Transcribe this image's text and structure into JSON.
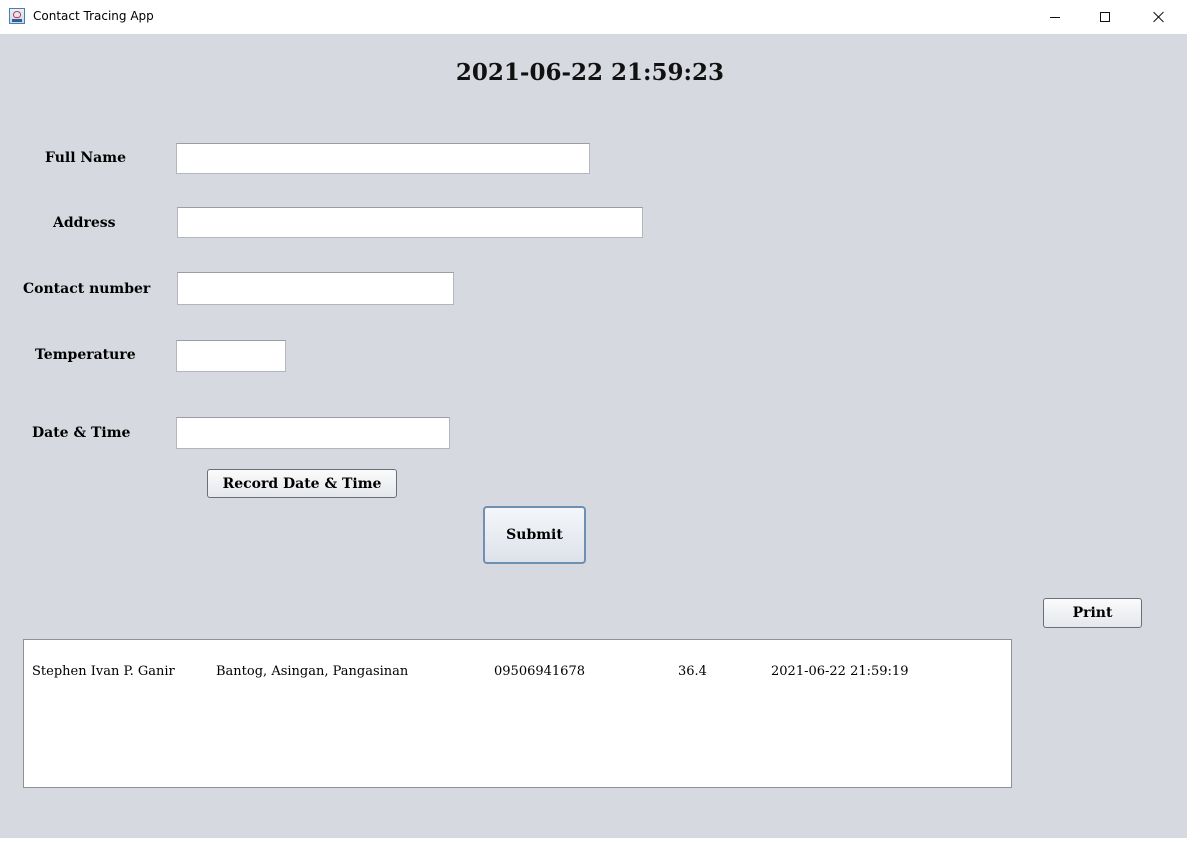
{
  "window": {
    "title": "Contact Tracing App",
    "controls": {
      "minimize": "minimize-icon",
      "maximize": "maximize-icon",
      "close": "close-icon"
    }
  },
  "clock": "2021-06-22 21:59:23",
  "form": {
    "full_name": {
      "label": "Full Name",
      "value": ""
    },
    "address": {
      "label": "Address",
      "value": ""
    },
    "contact": {
      "label": "Contact number",
      "value": ""
    },
    "temperature": {
      "label": "Temperature",
      "value": ""
    },
    "datetime": {
      "label": "Date & Time",
      "value": ""
    }
  },
  "buttons": {
    "record": "Record Date & Time",
    "submit": "Submit",
    "print": "Print"
  },
  "records": [
    {
      "name": "Stephen Ivan P. Ganir",
      "address": "Bantog, Asingan, Pangasinan",
      "contact": "09506941678",
      "temperature": "36.4",
      "datetime": "2021-06-22 21:59:19"
    }
  ],
  "colors": {
    "background": "#d6d9e0",
    "field": "#ffffff",
    "submit_border": "#6f8fb3"
  }
}
